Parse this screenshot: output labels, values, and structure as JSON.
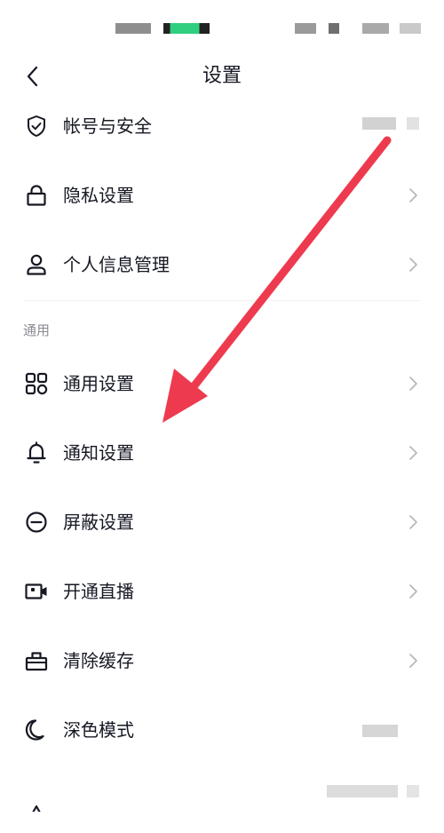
{
  "header": {
    "title": "设置"
  },
  "account_section": {
    "items": [
      {
        "label": "帐号与安全",
        "icon": "shield-check-icon"
      },
      {
        "label": "隐私设置",
        "icon": "lock-icon"
      },
      {
        "label": "个人信息管理",
        "icon": "person-icon"
      }
    ]
  },
  "general_section": {
    "header": "通用",
    "items": [
      {
        "label": "通用设置",
        "icon": "grid-icon"
      },
      {
        "label": "通知设置",
        "icon": "bell-icon"
      },
      {
        "label": "屏蔽设置",
        "icon": "block-icon"
      },
      {
        "label": "开通直播",
        "icon": "video-camera-icon"
      },
      {
        "label": "清除缓存",
        "icon": "toolbox-icon"
      },
      {
        "label": "深色模式",
        "icon": "moon-icon"
      }
    ]
  },
  "colors": {
    "text": "#161823",
    "secondary": "#8a8b91",
    "chevron": "#b4b5b9",
    "annotation_arrow": "#ee3a4f",
    "status_green": "#2fcf7f"
  }
}
